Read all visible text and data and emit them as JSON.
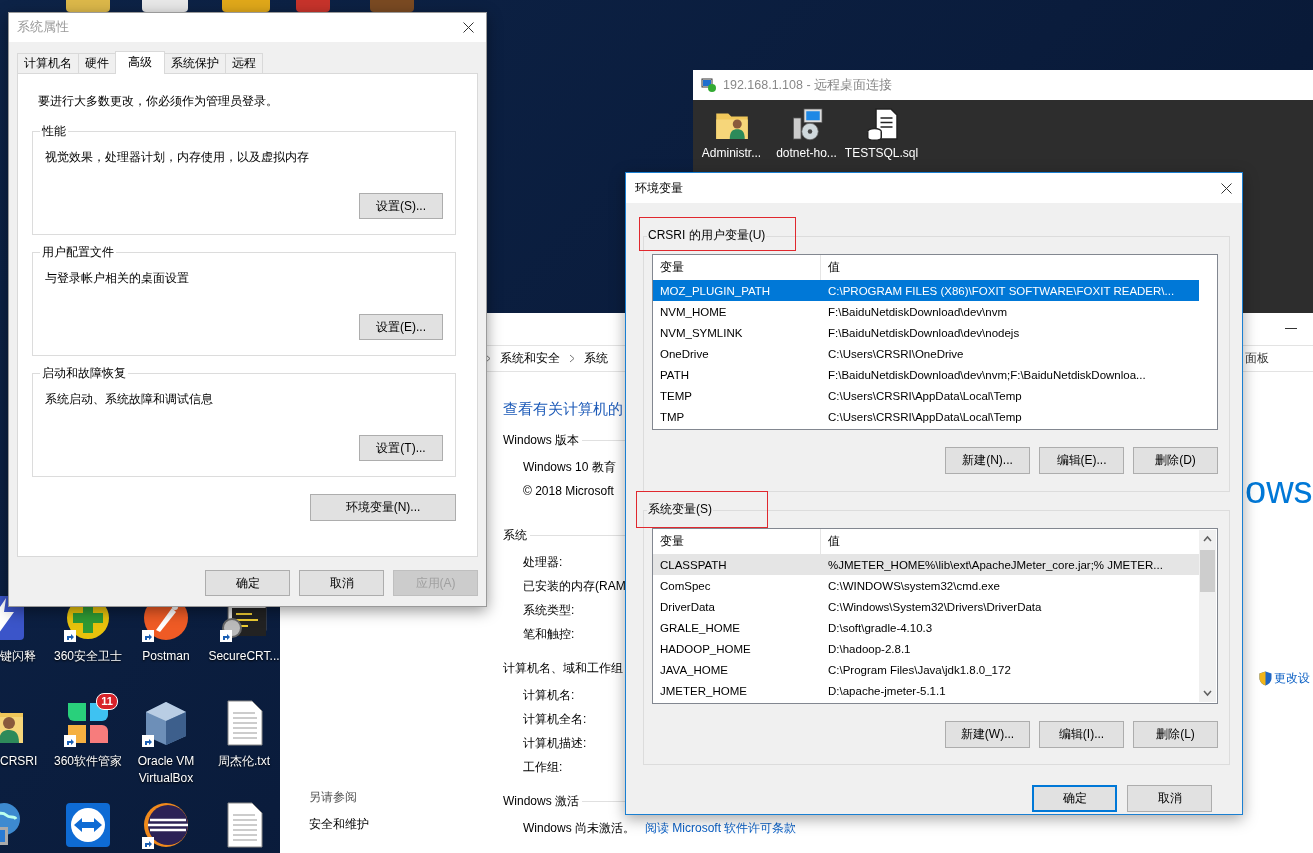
{
  "desktop_icons": [
    {
      "kind": "lightning",
      "label": "键闪释",
      "shortcut": false
    },
    {
      "kind": "plus",
      "label": "360安全卫士",
      "shortcut": true
    },
    {
      "kind": "circle-logo",
      "label": "Postman",
      "shortcut": true
    },
    {
      "kind": "terminal-lock",
      "label": "SecureCRT...",
      "shortcut": true
    },
    {
      "kind": "user-folder",
      "label": "CRSRI",
      "shortcut": false
    },
    {
      "kind": "petals",
      "label": "360软件管家",
      "shortcut": true,
      "badge": "11"
    },
    {
      "kind": "cube",
      "label": "Oracle VM VirtualBox",
      "shortcut": true
    },
    {
      "kind": "document",
      "label": "周杰伦.txt",
      "shortcut": false
    },
    {
      "kind": "globe-monitor",
      "shortcut": false
    },
    {
      "kind": "double-arrow",
      "shortcut": false
    },
    {
      "kind": "striped-circle",
      "shortcut": true
    },
    {
      "kind": "document",
      "shortcut": false
    }
  ],
  "control_panel": {
    "breadcrumb": [
      "系统和安全",
      "系统"
    ],
    "breadcrumb_right": "面板",
    "heading": "查看有关计算机的",
    "sections": [
      {
        "title": "Windows 版本",
        "items": [
          {
            "text": "Windows 10 教育"
          },
          {
            "text": "© 2018 Microsoft"
          }
        ]
      },
      {
        "title": "系统",
        "items": [
          {
            "text": "处理器:"
          },
          {
            "text": "已安装的内存(RAM"
          },
          {
            "text": "系统类型:"
          },
          {
            "text": "笔和触控:"
          }
        ]
      },
      {
        "title": "计算机名、域和工作组",
        "items": [
          {
            "text": "计算机名:"
          },
          {
            "text": "计算机全名:"
          },
          {
            "text": "计算机描述:"
          },
          {
            "text": "工作组:"
          }
        ]
      },
      {
        "title": "Windows 激活",
        "items": [
          {
            "text": "Windows 尚未激活。",
            "link": "阅读 Microsoft 软件许可条款"
          }
        ]
      }
    ],
    "see_also": {
      "title": "另请参阅",
      "links": [
        "安全和维护"
      ]
    },
    "logo_text": "ows",
    "change_link": "更改设"
  },
  "remote_desktop": {
    "title": "192.168.1.108 - 远程桌面连接",
    "icons": [
      {
        "kind": "user-folder",
        "label": "Administr..."
      },
      {
        "kind": "computer-disc",
        "label": "dotnet-ho..."
      },
      {
        "kind": "database-document",
        "label": "TESTSQL.sql"
      }
    ]
  },
  "system_properties": {
    "title": "系统属性",
    "tabs": [
      {
        "label": "计算机名",
        "selected": false
      },
      {
        "label": "硬件",
        "selected": false
      },
      {
        "label": "高级",
        "selected": true
      },
      {
        "label": "系统保护",
        "selected": false
      },
      {
        "label": "远程",
        "selected": false
      }
    ],
    "notice": "要进行大多数更改，你必须作为管理员登录。",
    "groups": [
      {
        "title": "性能",
        "description": "视觉效果，处理器计划，内存使用，以及虚拟内存",
        "button": "设置(S)..."
      },
      {
        "title": "用户配置文件",
        "description": "与登录帐户相关的桌面设置",
        "button": "设置(E)..."
      },
      {
        "title": "启动和故障恢复",
        "description": "系统启动、系统故障和调试信息",
        "button": "设置(T)..."
      }
    ],
    "env_button": "环境变量(N)...",
    "buttons": [
      {
        "label": "确定",
        "disabled": false
      },
      {
        "label": "取消",
        "disabled": false
      },
      {
        "label": "应用(A)",
        "disabled": true
      }
    ]
  },
  "environment_variables": {
    "title": "环境变量",
    "groups": [
      {
        "title": "CRSRI 的用户变量(U)",
        "highlighted": true,
        "list_focused": true,
        "scrollbar": false,
        "columns": [
          "变量",
          "值"
        ],
        "rows": [
          {
            "name": "MOZ_PLUGIN_PATH",
            "value": "C:\\PROGRAM FILES (X86)\\FOXIT SOFTWARE\\FOXIT READER\\...",
            "selected": true
          },
          {
            "name": "NVM_HOME",
            "value": "F:\\BaiduNetdiskDownload\\dev\\nvm",
            "selected": false
          },
          {
            "name": "NVM_SYMLINK",
            "value": "F:\\BaiduNetdiskDownload\\dev\\nodejs",
            "selected": false
          },
          {
            "name": "OneDrive",
            "value": "C:\\Users\\CRSRI\\OneDrive",
            "selected": false
          },
          {
            "name": "PATH",
            "value": "F:\\BaiduNetdiskDownload\\dev\\nvm;F:\\BaiduNetdiskDownloa...",
            "selected": false
          },
          {
            "name": "TEMP",
            "value": "C:\\Users\\CRSRI\\AppData\\Local\\Temp",
            "selected": false
          },
          {
            "name": "TMP",
            "value": "C:\\Users\\CRSRI\\AppData\\Local\\Temp",
            "selected": false
          }
        ],
        "buttons": [
          "新建(N)...",
          "编辑(E)...",
          "删除(D)"
        ]
      },
      {
        "title": "系统变量(S)",
        "highlighted": true,
        "list_focused": false,
        "scrollbar": true,
        "columns": [
          "变量",
          "值"
        ],
        "rows": [
          {
            "name": "CLASSPATH",
            "value": "%JMETER_HOME%\\lib\\ext\\ApacheJMeter_core.jar;% JMETER...",
            "selected": true
          },
          {
            "name": "ComSpec",
            "value": "C:\\WINDOWS\\system32\\cmd.exe",
            "selected": false
          },
          {
            "name": "DriverData",
            "value": "C:\\Windows\\System32\\Drivers\\DriverData",
            "selected": false
          },
          {
            "name": "GRALE_HOME",
            "value": "D:\\soft\\gradle-4.10.3",
            "selected": false
          },
          {
            "name": "HADOOP_HOME",
            "value": "D:\\hadoop-2.8.1",
            "selected": false
          },
          {
            "name": "JAVA_HOME",
            "value": "C:\\Program Files\\Java\\jdk1.8.0_172",
            "selected": false
          },
          {
            "name": "JMETER_HOME",
            "value": "D:\\apache-jmeter-5.1.1",
            "selected": false
          }
        ],
        "buttons": [
          "新建(W)...",
          "编辑(I)...",
          "删除(L)"
        ]
      }
    ],
    "buttons": [
      {
        "label": "确定",
        "default": true
      },
      {
        "label": "取消",
        "default": false
      }
    ]
  }
}
